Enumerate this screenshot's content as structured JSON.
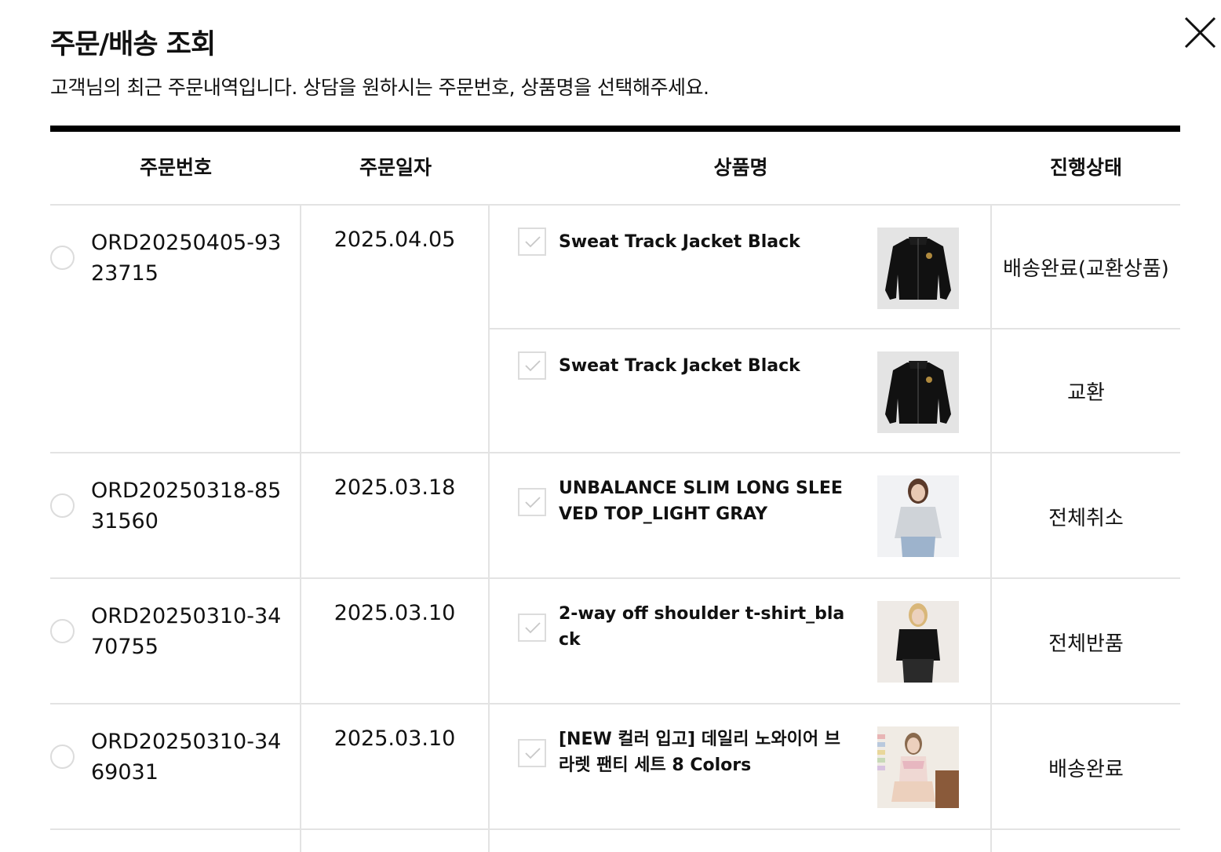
{
  "modal": {
    "title": "주문/배송 조회",
    "subtitle": "고객님의 최근 주문내역입니다. 상담을 원하시는 주문번호, 상품명을 선택해주세요."
  },
  "table": {
    "headers": {
      "order_no": "주문번호",
      "order_date": "주문일자",
      "product": "상품명",
      "status": "진행상태"
    },
    "orders": [
      {
        "order_no": "ORD20250405-9323715",
        "date": "2025.04.05",
        "items": [
          {
            "name": "Sweat Track Jacket Black",
            "status": "배송완료(교환상품)",
            "thumb": "black-track-jacket"
          },
          {
            "name": "Sweat Track Jacket Black",
            "status": "교환",
            "thumb": "black-track-jacket"
          }
        ]
      },
      {
        "order_no": "ORD20250318-8531560",
        "date": "2025.03.18",
        "items": [
          {
            "name": "UNBALANCE SLIM LONG SLEEVED TOP_LIGHT GRAY",
            "status": "전체취소",
            "thumb": "model-light-gray-top"
          }
        ]
      },
      {
        "order_no": "ORD20250310-3470755",
        "date": "2025.03.10",
        "items": [
          {
            "name": "2-way off shoulder t-shirt_black",
            "status": "전체반품",
            "thumb": "model-black-off-shoulder"
          }
        ]
      },
      {
        "order_no": "ORD20250310-3469031",
        "date": "2025.03.10",
        "items": [
          {
            "name": "[NEW 컬러 입고] 데일리 노와이어 브라렛 팬티 세트 8 Colors",
            "status": "배송완료",
            "thumb": "model-bralette-set"
          }
        ]
      }
    ]
  }
}
